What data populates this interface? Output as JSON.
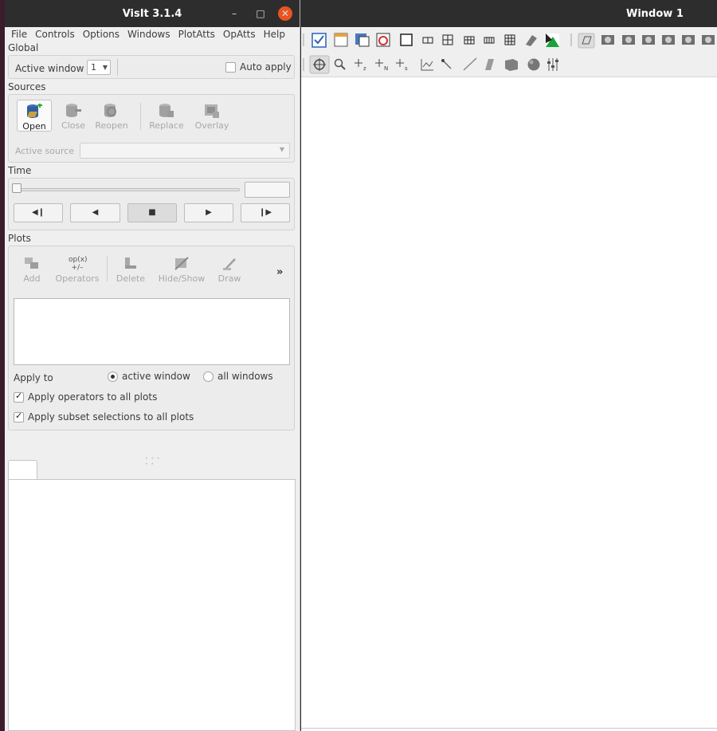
{
  "main_window": {
    "title": "VisIt 3.1.4",
    "controls": {
      "minimize": "–",
      "maximize": "□",
      "close": "✕"
    },
    "menu": [
      "File",
      "Controls",
      "Options",
      "Windows",
      "PlotAtts",
      "OpAtts",
      "Help"
    ],
    "global": {
      "section_label": "Global",
      "active_window_label": "Active window",
      "active_window_value": "1",
      "auto_apply_label": "Auto apply",
      "auto_apply_checked": false
    },
    "sources": {
      "section_label": "Sources",
      "buttons": {
        "open": "Open",
        "close": "Close",
        "reopen": "Reopen",
        "replace": "Replace",
        "overlay": "Overlay"
      },
      "active_source_label": "Active source",
      "active_source_value": ""
    },
    "time": {
      "section_label": "Time",
      "slider_value": 0,
      "time_field": "",
      "vcr_icons": [
        "step-back-icon",
        "reverse-play-icon",
        "stop-icon",
        "play-icon",
        "step-forward-icon"
      ]
    },
    "plots": {
      "section_label": "Plots",
      "buttons": {
        "add": "Add",
        "operators": "Operators",
        "delete": "Delete",
        "hide_show": "Hide/Show",
        "draw": "Draw",
        "more": "»"
      },
      "operators_icon_text": "op(x)",
      "apply_to_label": "Apply to",
      "active_window_option": "active window",
      "all_windows_option": "all windows",
      "apply_to_selected": "active window",
      "apply_operators_label": "Apply operators to all plots",
      "apply_operators_checked": true,
      "apply_subset_label": "Apply subset selections to all plots",
      "apply_subset_checked": true
    }
  },
  "viz_window": {
    "title": "Window 1"
  },
  "colors": {
    "titlebar": "#2d2d2d",
    "close_button": "#e95420",
    "panel_bg": "#efefef"
  }
}
